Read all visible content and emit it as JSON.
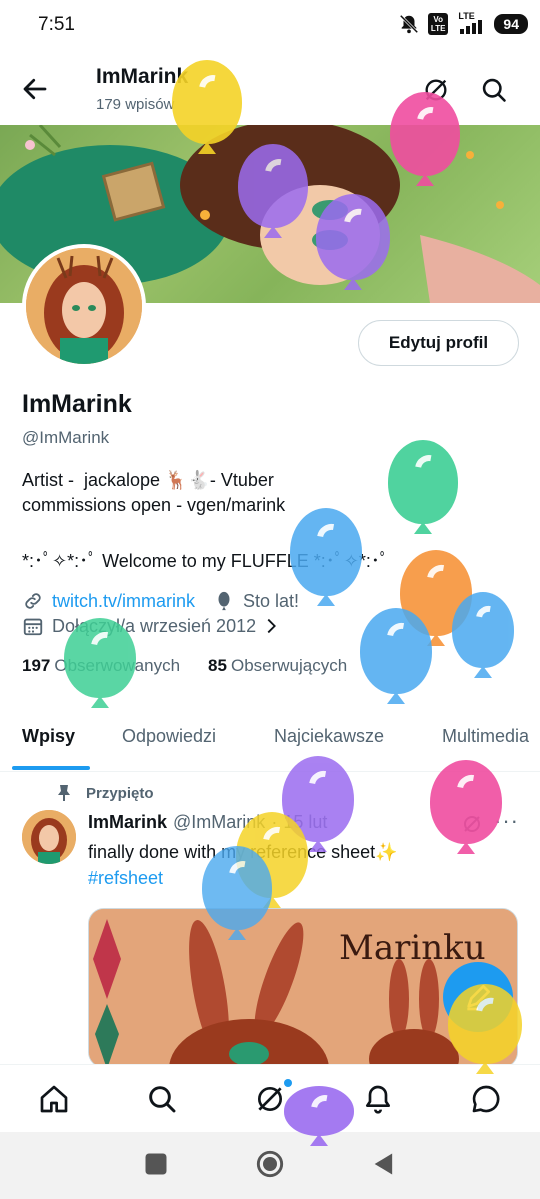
{
  "status_bar": {
    "time": "7:51",
    "volte_label": "Vo\nLTE",
    "lte_label": "LTE",
    "battery": "94"
  },
  "header": {
    "title": "ImMarink",
    "subtitle": "179 wpisów",
    "icons": [
      "back-arrow-icon",
      "grok-icon",
      "search-icon"
    ]
  },
  "profile": {
    "edit_button": "Edytuj profil",
    "name": "ImMarink",
    "handle": "@ImMarink",
    "bio_line1": "Artist -  jackalope 🦌🐇- Vtuber",
    "bio_line2": "commissions open - vgen/marink",
    "bio_welcome": "*:･ﾟ✧*:･ﾟ Welcome to my FLUFFLE *:･ﾟ✧*:･ﾟ",
    "link": "twitch.tv/immarink",
    "birthday": "Sto lat!",
    "joined": "Dołączył/a wrzesień 2012",
    "following_count": "197",
    "following_label": "Obserwowanych",
    "followers_count": "85",
    "followers_label": "Obserwujących"
  },
  "tabs": [
    {
      "label": "Wpisy",
      "active": true
    },
    {
      "label": "Odpowiedzi",
      "active": false
    },
    {
      "label": "Najciekawsze",
      "active": false
    },
    {
      "label": "Multimedia",
      "active": false
    }
  ],
  "tweet": {
    "pinned_label": "Przypięto",
    "author_name": "ImMarink",
    "author_handle": "@ImMarink",
    "separator": "·",
    "date": "15 lut",
    "more": "···",
    "text": "finally done with my reference sheet✨",
    "hashtag": "#refsheet",
    "image_text": "Marinku"
  },
  "bottom_nav": [
    "home-icon",
    "search-icon",
    "grok-icon",
    "notifications-icon",
    "messages-icon"
  ],
  "system_nav": [
    "recents-icon",
    "home-circle-icon",
    "back-triangle-icon"
  ],
  "colors": {
    "accent": "#1d9bf0",
    "text_primary": "#0f1419",
    "text_secondary": "#536471",
    "balloon_yellow": "#f5d327",
    "balloon_pink": "#f04da0",
    "balloon_purple": "#9b6cf0",
    "balloon_green": "#3ecf95",
    "balloon_blue": "#4aa9f0",
    "balloon_orange": "#f7943a"
  }
}
